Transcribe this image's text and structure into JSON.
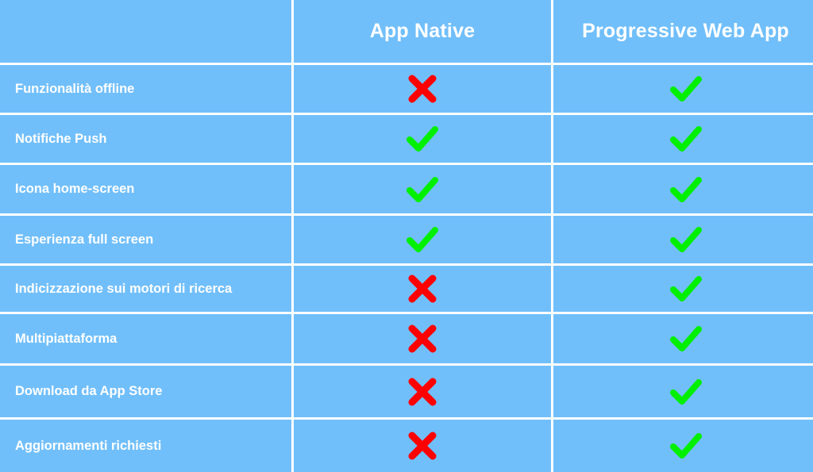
{
  "table": {
    "corner": "",
    "columns": [
      "App Native",
      "Progressive Web App"
    ],
    "colors": {
      "background": "#71bffa",
      "grid_lines": "#ffffff",
      "text": "#ffffff",
      "check": "#00f000",
      "cross": "#ff0000"
    },
    "rows": [
      {
        "feature": "Funzionalità offline",
        "native": "cross-icon",
        "pwa": "check-icon"
      },
      {
        "feature": "Notifiche Push",
        "native": "check-icon",
        "pwa": "check-icon"
      },
      {
        "feature": "Icona home-screen",
        "native": "check-icon",
        "pwa": "check-icon"
      },
      {
        "feature": "Esperienza full screen",
        "native": "check-icon",
        "pwa": "check-icon"
      },
      {
        "feature": "Indicizzazione sui motori di ricerca",
        "native": "cross-icon",
        "pwa": "check-icon"
      },
      {
        "feature": "Multipiattaforma",
        "native": "cross-icon",
        "pwa": "check-icon"
      },
      {
        "feature": "Download da App Store",
        "native": "cross-icon",
        "pwa": "check-icon"
      },
      {
        "feature": "Aggiornamenti richiesti",
        "native": "cross-icon",
        "pwa": "check-icon"
      }
    ]
  }
}
